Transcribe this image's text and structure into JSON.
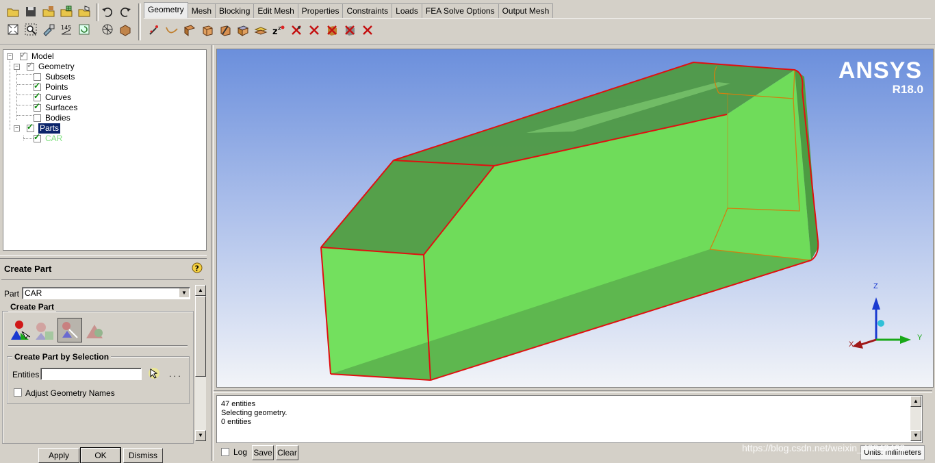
{
  "tabs": [
    "Geometry",
    "Mesh",
    "Blocking",
    "Edit Mesh",
    "Properties",
    "Constraints",
    "Loads",
    "FEA Solve Options",
    "Output Mesh"
  ],
  "active_tab": "Geometry",
  "tree": {
    "model": "Model",
    "geometry": "Geometry",
    "subsets": "Subsets",
    "points": "Points",
    "curves": "Curves",
    "surfaces": "Surfaces",
    "bodies": "Bodies",
    "parts": "Parts",
    "car": "CAR"
  },
  "panel": {
    "title": "Create Part",
    "part_label": "Part",
    "part_value": "CAR",
    "group_title": "Create Part",
    "selection_title": "Create Part by Selection",
    "entities_label": "Entities",
    "entities_value": "",
    "dots": ". . .",
    "adjust_label": "Adjust Geometry Names",
    "apply": "Apply",
    "ok": "OK",
    "dismiss": "Dismiss"
  },
  "viewport": {
    "logo": "ANSYS",
    "version": "R18.0",
    "axis_x": "X",
    "axis_y": "Y",
    "axis_z": "Z"
  },
  "messages": [
    "47 entities",
    "Selecting geometry.",
    "0 entities"
  ],
  "bottom": {
    "log": "Log",
    "save": "Save",
    "clear": "Clear",
    "units": "Units: millimeters"
  },
  "watermark": "https://blog.csdn.net/weixin_43842462",
  "colors": {
    "body_fill": "#6fdc5a",
    "edge": "#e01010",
    "bg_top": "#6b8fdc",
    "bg_bottom": "#f2f4f8"
  }
}
